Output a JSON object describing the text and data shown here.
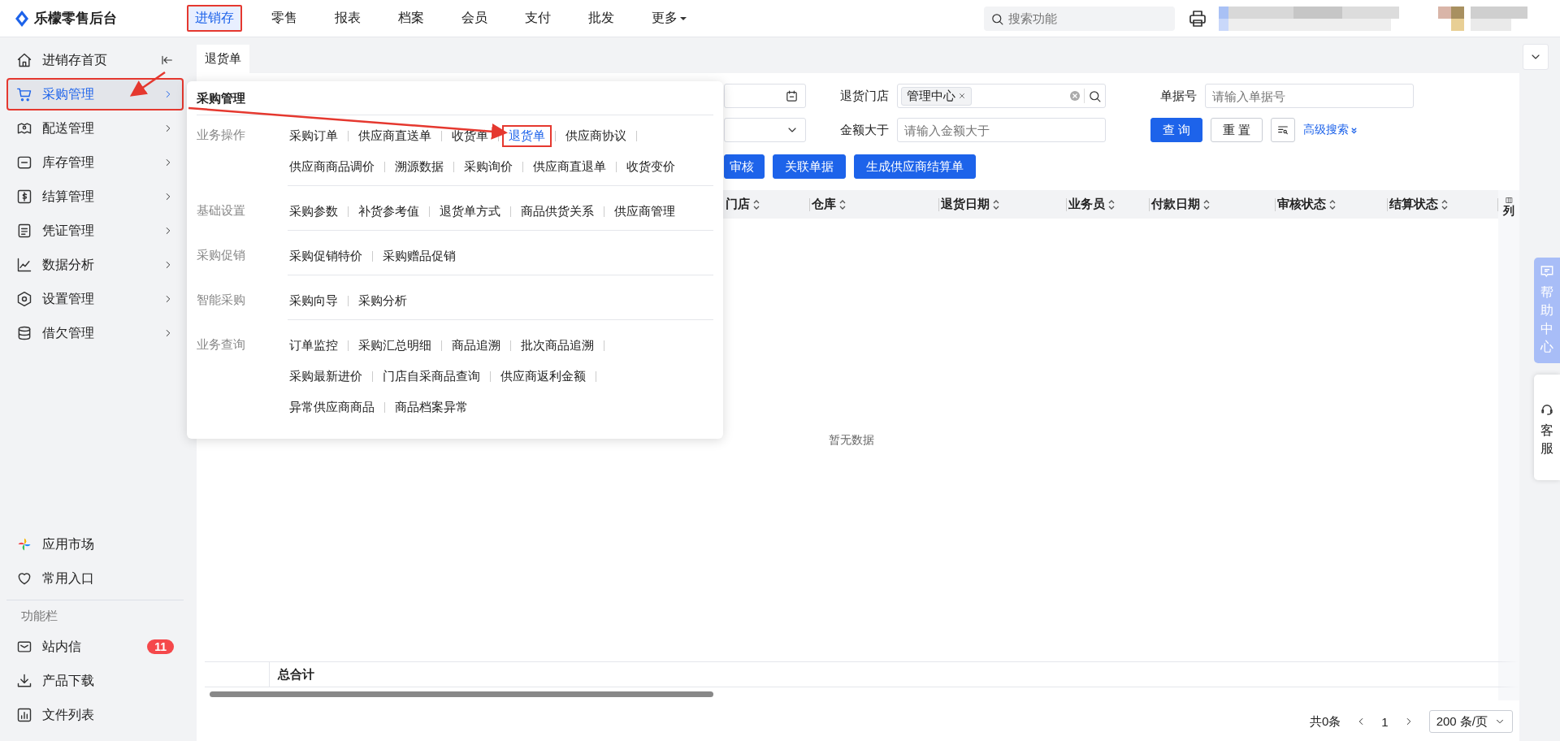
{
  "app": {
    "title": "乐檬零售后台"
  },
  "top_nav": [
    {
      "label": "进销存",
      "selected": true,
      "highlighted": true
    },
    {
      "label": "零售",
      "selected": false,
      "highlighted": false
    },
    {
      "label": "报表",
      "selected": false,
      "highlighted": false
    },
    {
      "label": "档案",
      "selected": false,
      "highlighted": false
    },
    {
      "label": "会员",
      "selected": false,
      "highlighted": false
    },
    {
      "label": "支付",
      "selected": false,
      "highlighted": false
    },
    {
      "label": "批发",
      "selected": false,
      "highlighted": false
    },
    {
      "label": "更多",
      "selected": false,
      "highlighted": false,
      "kind": "dropdown"
    }
  ],
  "search": {
    "placeholder": "搜索功能"
  },
  "sidebar": {
    "home": {
      "label": "进销存首页"
    },
    "items": [
      {
        "label": "采购管理",
        "selected": true,
        "highlighted": true
      },
      {
        "label": "配送管理",
        "selected": false,
        "highlighted": false
      },
      {
        "label": "库存管理",
        "selected": false,
        "highlighted": false
      },
      {
        "label": "结算管理",
        "selected": false,
        "highlighted": false
      },
      {
        "label": "凭证管理",
        "selected": false,
        "highlighted": false
      },
      {
        "label": "数据分析",
        "selected": false,
        "highlighted": false
      },
      {
        "label": "设置管理",
        "selected": false,
        "highlighted": false
      },
      {
        "label": "借欠管理",
        "selected": false,
        "highlighted": false
      }
    ],
    "shortcuts": [
      {
        "label": "应用市场"
      },
      {
        "label": "常用入口"
      }
    ],
    "tools_heading": "功能栏",
    "tools": [
      {
        "label": "站内信",
        "badge": "11"
      },
      {
        "label": "产品下载"
      },
      {
        "label": "文件列表"
      }
    ]
  },
  "flyout": {
    "title": "采购管理",
    "sections": [
      {
        "label": "业务操作",
        "rows": [
          {
            "items": [
              {
                "label": "采购订单",
                "selected": false,
                "highlighted": false
              },
              {
                "label": "供应商直送单",
                "selected": false,
                "highlighted": false
              },
              {
                "label": "收货单",
                "selected": false,
                "highlighted": false
              },
              {
                "label": "退货单",
                "selected": true,
                "highlighted": true
              },
              {
                "label": "供应商协议",
                "selected": false,
                "highlighted": false
              }
            ]
          },
          {
            "items": [
              {
                "label": "供应商商品调价",
                "selected": false,
                "highlighted": false
              },
              {
                "label": "溯源数据",
                "selected": false,
                "highlighted": false
              },
              {
                "label": "采购询价",
                "selected": false,
                "highlighted": false
              },
              {
                "label": "供应商直退单",
                "selected": false,
                "highlighted": false
              },
              {
                "label": "收货变价",
                "selected": false,
                "highlighted": false
              }
            ]
          }
        ]
      },
      {
        "label": "基础设置",
        "rows": [
          {
            "items": [
              {
                "label": "采购参数",
                "selected": false,
                "highlighted": false
              },
              {
                "label": "补货参考值",
                "selected": false,
                "highlighted": false
              },
              {
                "label": "退货单方式",
                "selected": false,
                "highlighted": false
              },
              {
                "label": "商品供货关系",
                "selected": false,
                "highlighted": false
              },
              {
                "label": "供应商管理",
                "selected": false,
                "highlighted": false
              }
            ]
          }
        ]
      },
      {
        "label": "采购促销",
        "rows": [
          {
            "items": [
              {
                "label": "采购促销特价",
                "selected": false,
                "highlighted": false
              },
              {
                "label": "采购赠品促销",
                "selected": false,
                "highlighted": false
              }
            ]
          }
        ]
      },
      {
        "label": "智能采购",
        "rows": [
          {
            "items": [
              {
                "label": "采购向导",
                "selected": false,
                "highlighted": false
              },
              {
                "label": "采购分析",
                "selected": false,
                "highlighted": false
              }
            ]
          }
        ]
      },
      {
        "label": "业务查询",
        "rows": [
          {
            "items": [
              {
                "label": "订单监控",
                "selected": false,
                "highlighted": false
              },
              {
                "label": "采购汇总明细",
                "selected": false,
                "highlighted": false
              },
              {
                "label": "商品追溯",
                "selected": false,
                "highlighted": false
              },
              {
                "label": "批次商品追溯",
                "selected": false,
                "highlighted": false
              }
            ]
          },
          {
            "items": [
              {
                "label": "采购最新进价",
                "selected": false,
                "highlighted": false
              },
              {
                "label": "门店自采商品查询",
                "selected": false,
                "highlighted": false
              },
              {
                "label": "供应商返利金额",
                "selected": false,
                "highlighted": false
              }
            ]
          },
          {
            "items": [
              {
                "label": "异常供应商商品",
                "selected": false,
                "highlighted": false
              },
              {
                "label": "商品档案异常",
                "selected": false,
                "highlighted": false
              }
            ]
          }
        ]
      }
    ]
  },
  "tabs": [
    {
      "label": "退货单",
      "selected": true
    }
  ],
  "filters": [
    [
      {
        "kind": "date"
      },
      {
        "kind": "tags",
        "label": "退货门店",
        "tags": [
          "管理中心"
        ]
      },
      {
        "kind": "text",
        "label": "单据号",
        "placeholder": "请输入单据号"
      }
    ],
    [
      {
        "kind": "select"
      },
      {
        "kind": "text",
        "label": "金额大于",
        "placeholder": "请输入金额大于"
      }
    ]
  ],
  "search_buttons": {
    "query": "查 询",
    "reset": "重 置",
    "advanced": "高级搜索"
  },
  "actions": [
    {
      "label": "审核"
    },
    {
      "label": "关联单据"
    },
    {
      "label": "生成供应商结算单"
    }
  ],
  "table": {
    "columns": [
      "门店",
      "仓库",
      "退货日期",
      "业务员",
      "付款日期",
      "审核状态",
      "结算状态"
    ],
    "column_settings": "列",
    "empty_text": "暂无数据",
    "footer": "总合计"
  },
  "pagination": {
    "total": "共0条",
    "page": "1",
    "page_size": "200 条/页"
  },
  "side_tabs": {
    "help": "帮助中心",
    "service": "客服"
  }
}
